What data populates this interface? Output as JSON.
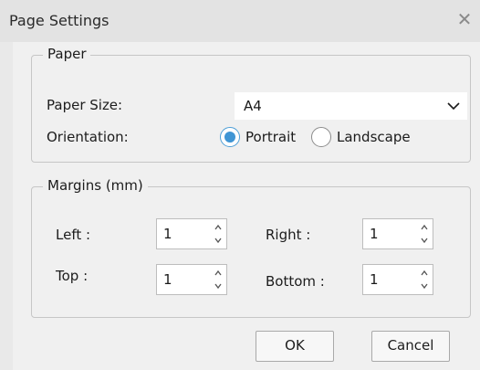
{
  "window": {
    "title": "Page Settings",
    "close_label": "✕"
  },
  "paper": {
    "legend": "Paper",
    "size_label": "Paper Size:",
    "size_value": "A4",
    "orientation_label": "Orientation:",
    "orientation_options": [
      {
        "label": "Portrait",
        "checked": true
      },
      {
        "label": "Landscape",
        "checked": false
      }
    ]
  },
  "margins": {
    "legend": "Margins (mm)",
    "left_label": "Left :",
    "left_value": "1",
    "right_label": "Right :",
    "right_value": "1",
    "top_label": "Top :",
    "top_value": "1",
    "bottom_label": "Bottom :",
    "bottom_value": "1"
  },
  "buttons": {
    "ok_label": "OK",
    "cancel_label": "Cancel"
  },
  "colors": {
    "radio_accent": "#3f95d4",
    "window_bg": "#f0f0f0"
  }
}
